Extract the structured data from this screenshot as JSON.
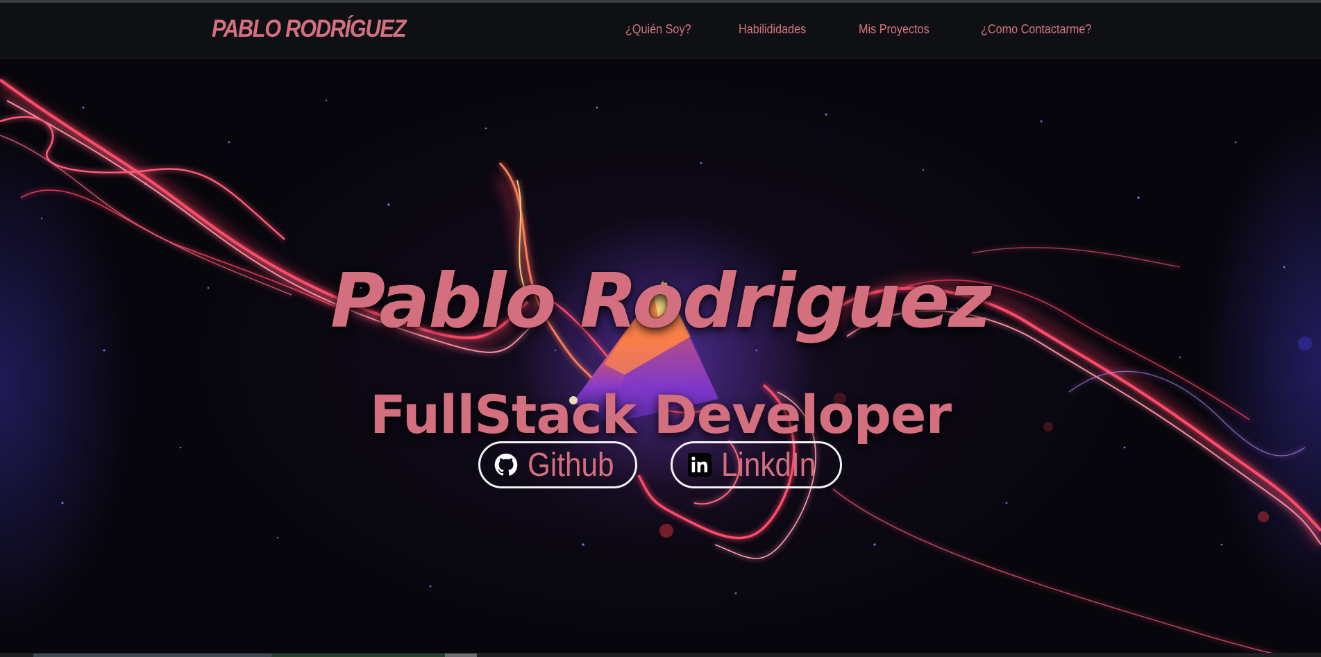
{
  "navbar": {
    "brand": "PABLO RODRÍGUEZ",
    "links": [
      {
        "label": "¿Quién Soy?"
      },
      {
        "label": "Habilididades"
      },
      {
        "label": "Mis Proyectos"
      },
      {
        "label": "¿Como Contactarme?"
      }
    ]
  },
  "hero": {
    "title": "Pablo Rodriguez",
    "subtitle": "FullStack Developer",
    "buttons": [
      {
        "label": "Github",
        "icon": "github-icon"
      },
      {
        "label": "LinkdIn",
        "icon": "linkedin-icon"
      }
    ]
  },
  "colors": {
    "accent": "#d46f7f",
    "navbar_bg": "#0f1013",
    "hero_bg": "#08070d",
    "button_border": "#f2f2f2"
  }
}
